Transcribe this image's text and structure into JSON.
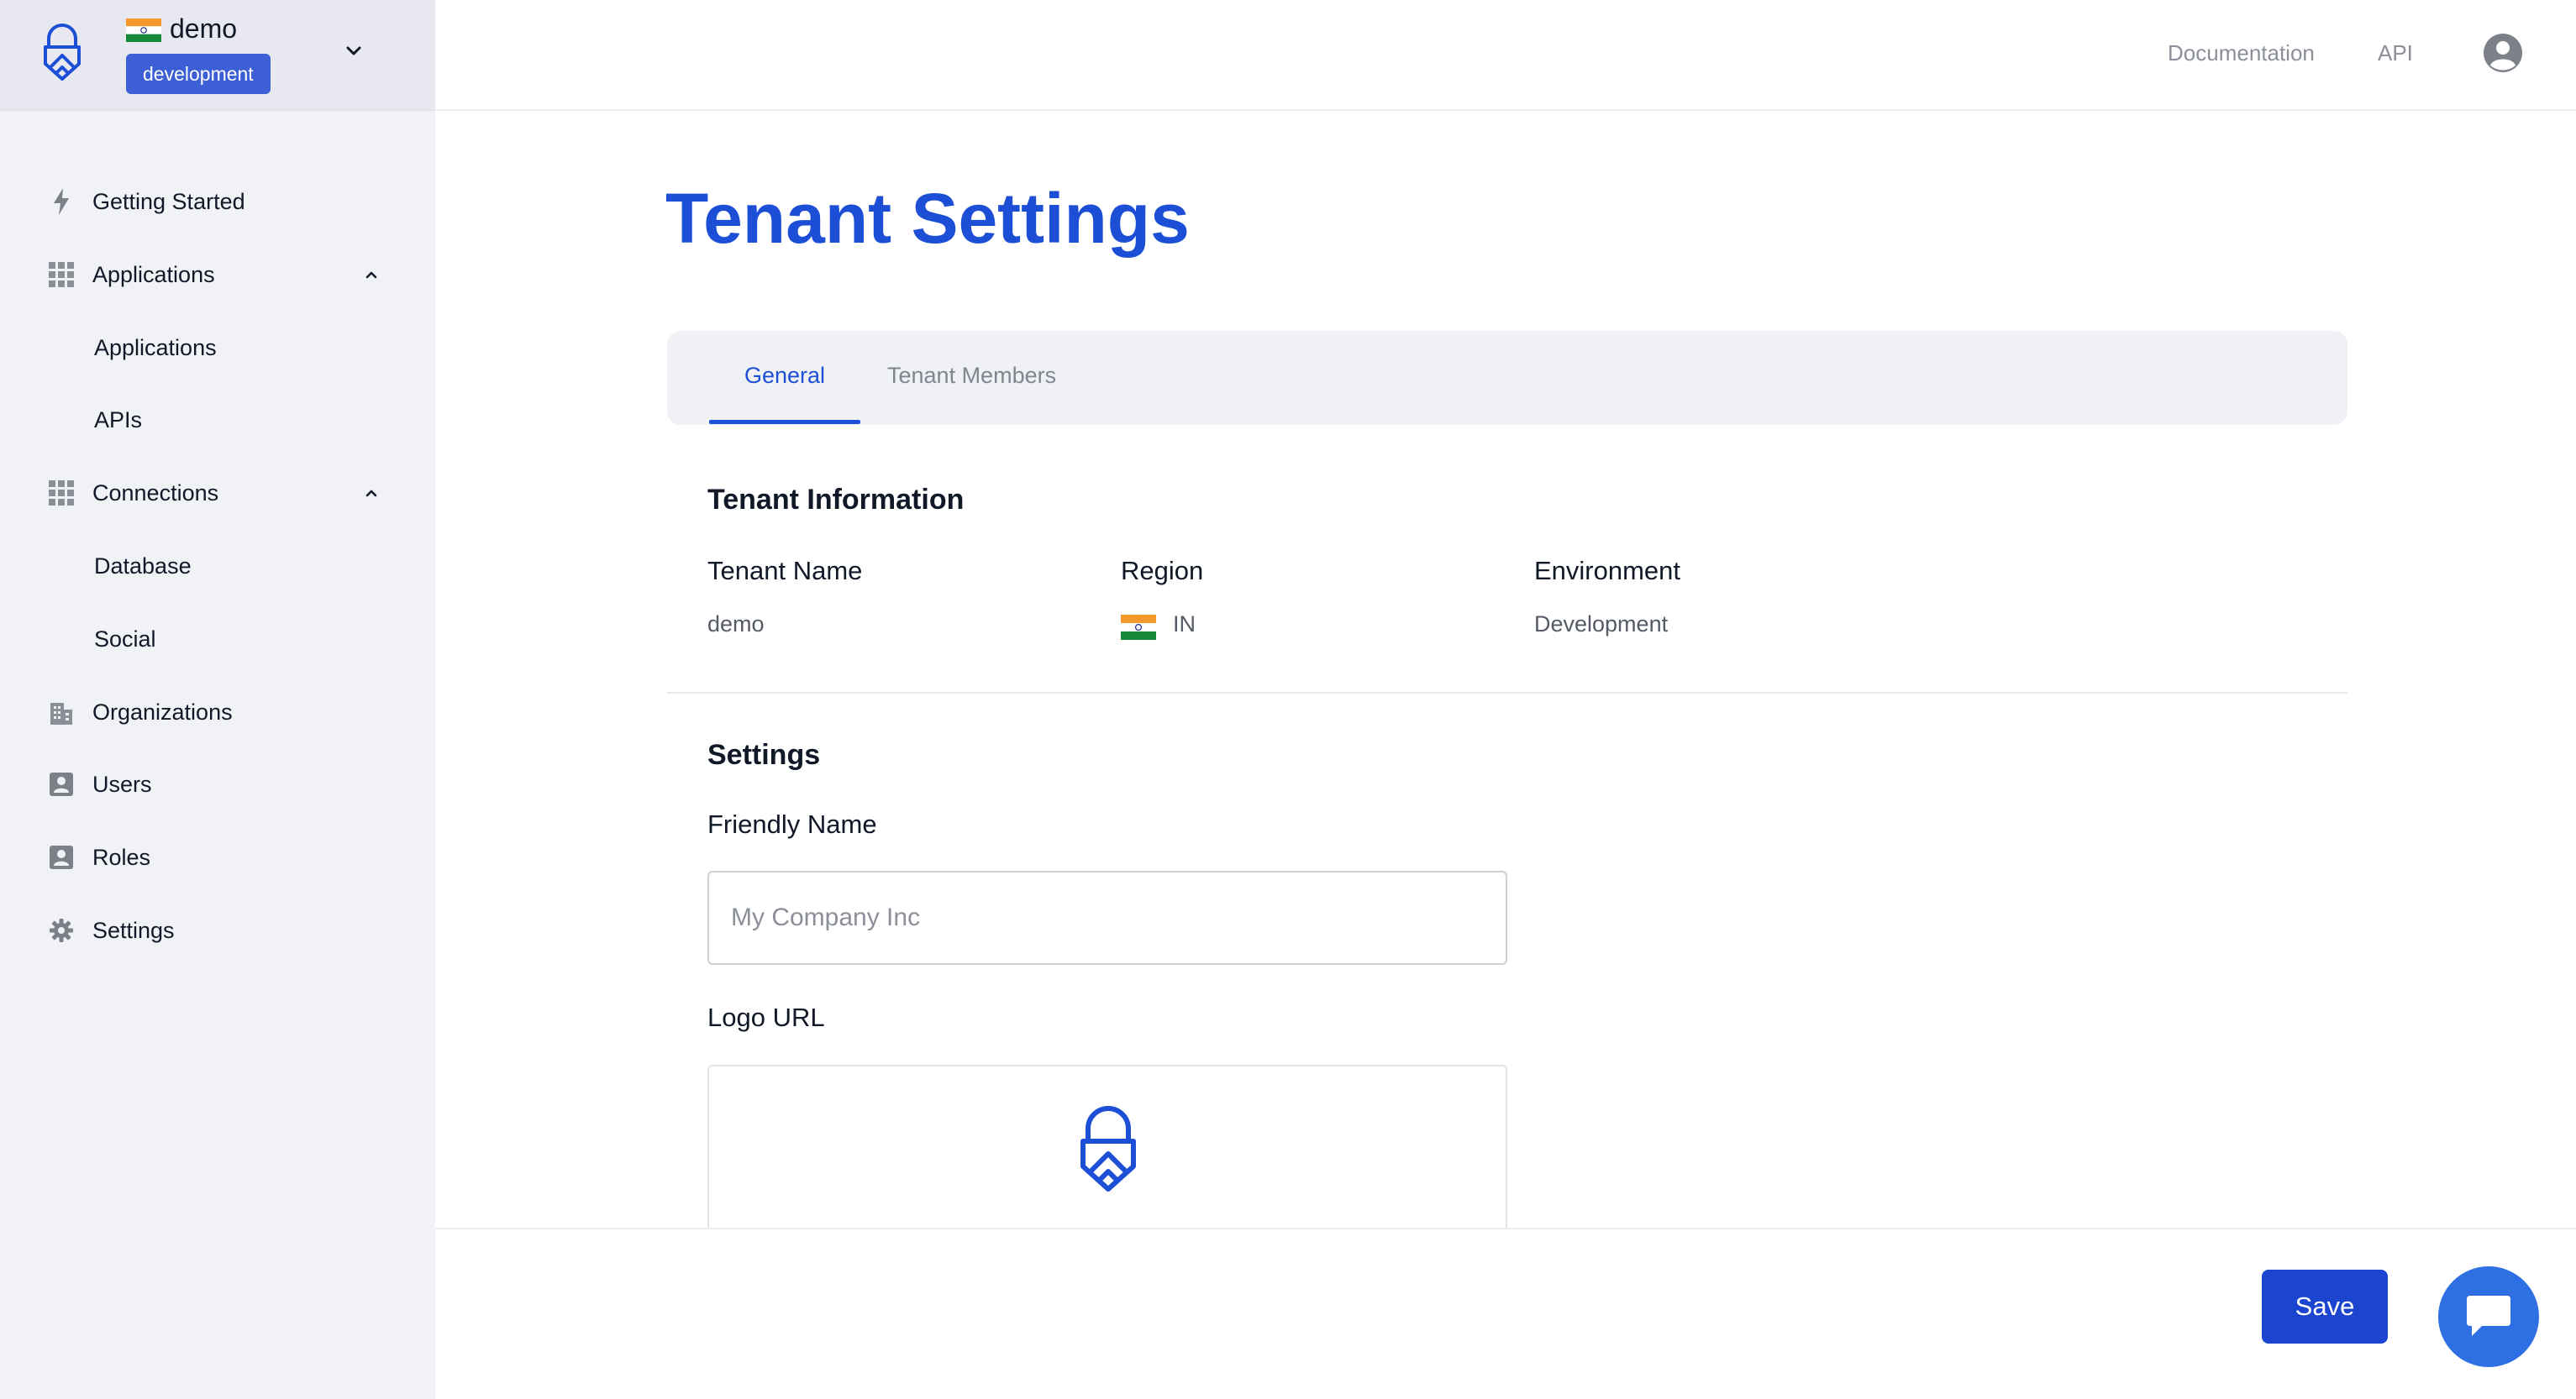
{
  "tenant": {
    "name": "demo",
    "environment_badge": "development",
    "flag_icon": "india-flag-icon"
  },
  "sidebar": {
    "items": [
      {
        "label": "Getting Started",
        "icon": "lightning-icon"
      },
      {
        "label": "Applications",
        "icon": "grid-icon",
        "expanded": true
      },
      {
        "label": "Applications",
        "sub": true
      },
      {
        "label": "APIs",
        "sub": true
      },
      {
        "label": "Connections",
        "icon": "grid-icon",
        "expanded": true
      },
      {
        "label": "Database",
        "sub": true
      },
      {
        "label": "Social",
        "sub": true
      },
      {
        "label": "Organizations",
        "icon": "building-icon"
      },
      {
        "label": "Users",
        "icon": "contact-card-icon"
      },
      {
        "label": "Roles",
        "icon": "contact-card-icon"
      },
      {
        "label": "Settings",
        "icon": "gear-icon"
      }
    ]
  },
  "topbar": {
    "documentation": "Documentation",
    "api": "API"
  },
  "page": {
    "title": "Tenant Settings",
    "tabs": [
      {
        "label": "General",
        "active": true
      },
      {
        "label": "Tenant Members",
        "active": false
      }
    ]
  },
  "tenant_info": {
    "title": "Tenant Information",
    "tenant_name_label": "Tenant Name",
    "tenant_name_value": "demo",
    "region_label": "Region",
    "region_value": "IN",
    "environment_label": "Environment",
    "environment_value": "Development"
  },
  "settings": {
    "title": "Settings",
    "friendly_name_label": "Friendly Name",
    "friendly_name_value": "",
    "friendly_name_placeholder": "My Company Inc",
    "logo_url_label": "Logo URL"
  },
  "footer": {
    "save_label": "Save"
  },
  "colors": {
    "brand": "#1c4fd6",
    "badge": "#3c5fd6",
    "save": "#1c45cf",
    "chat": "#2f6fe4",
    "sidebar_bg": "#f1f2f6"
  }
}
